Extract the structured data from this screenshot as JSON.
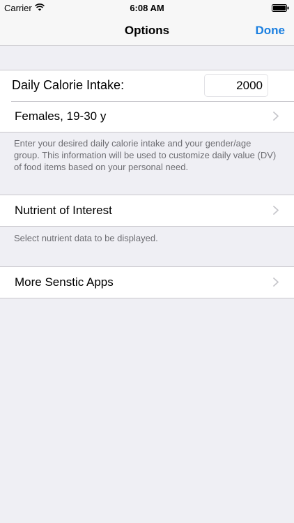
{
  "status_bar": {
    "carrier": "Carrier",
    "time": "6:08 AM"
  },
  "nav": {
    "title": "Options",
    "done_label": "Done"
  },
  "settings": {
    "calorie_label": "Daily Calorie Intake:",
    "calorie_value": "2000",
    "gender_age_label": "Females, 19-30 y",
    "calorie_footer": "Enter your desired daily calorie intake and your gender/age group.  This information will be used to customize daily value (DV) of food items based on your personal need.",
    "nutrient_label": "Nutrient of Interest",
    "nutrient_footer": "Select nutrient data to be displayed.",
    "more_apps_label": "More Senstic Apps"
  },
  "colors": {
    "accent": "#1a7fe0",
    "background": "#efeff4",
    "separator": "#c8c7cc",
    "footer_text": "#6d6d72"
  }
}
